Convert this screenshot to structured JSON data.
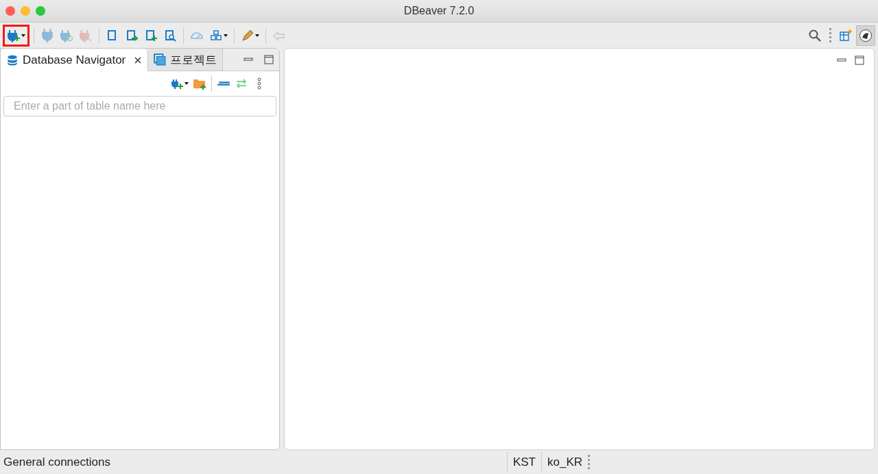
{
  "window": {
    "title": "DBeaver 7.2.0"
  },
  "toolbar": {
    "items": [
      {
        "kind": "new-connection",
        "disabled": false,
        "highlighted": true,
        "dropdown": true
      },
      {
        "kind": "sep"
      },
      {
        "kind": "connect",
        "disabled": true,
        "highlighted": false,
        "dropdown": false
      },
      {
        "kind": "reconnect",
        "disabled": true,
        "highlighted": false,
        "dropdown": false
      },
      {
        "kind": "disconnect",
        "disabled": true,
        "highlighted": false,
        "dropdown": false
      },
      {
        "kind": "sep"
      },
      {
        "kind": "commit",
        "disabled": false,
        "highlighted": false,
        "dropdown": false
      },
      {
        "kind": "rollback",
        "disabled": false,
        "highlighted": false,
        "dropdown": false
      },
      {
        "kind": "new-script",
        "disabled": false,
        "highlighted": false,
        "dropdown": false
      },
      {
        "kind": "find",
        "disabled": false,
        "highlighted": false,
        "dropdown": false
      },
      {
        "kind": "sep"
      },
      {
        "kind": "dashboard",
        "disabled": true,
        "highlighted": false,
        "dropdown": false
      },
      {
        "kind": "boxes",
        "disabled": false,
        "highlighted": false,
        "dropdown": true
      },
      {
        "kind": "sep"
      },
      {
        "kind": "pen",
        "disabled": false,
        "highlighted": false,
        "dropdown": true
      },
      {
        "kind": "sep"
      },
      {
        "kind": "back",
        "disabled": true,
        "highlighted": false,
        "dropdown": false
      }
    ]
  },
  "tabs": [
    {
      "label": "Database Navigator",
      "selected": true,
      "closable": true
    },
    {
      "label": "프로젝트",
      "selected": false,
      "closable": false
    }
  ],
  "navigator": {
    "filter": {
      "placeholder": "Enter a part of table name here"
    }
  },
  "status_bar": {
    "left": "General connections",
    "timezone": "KST",
    "locale": "ko_KR"
  }
}
